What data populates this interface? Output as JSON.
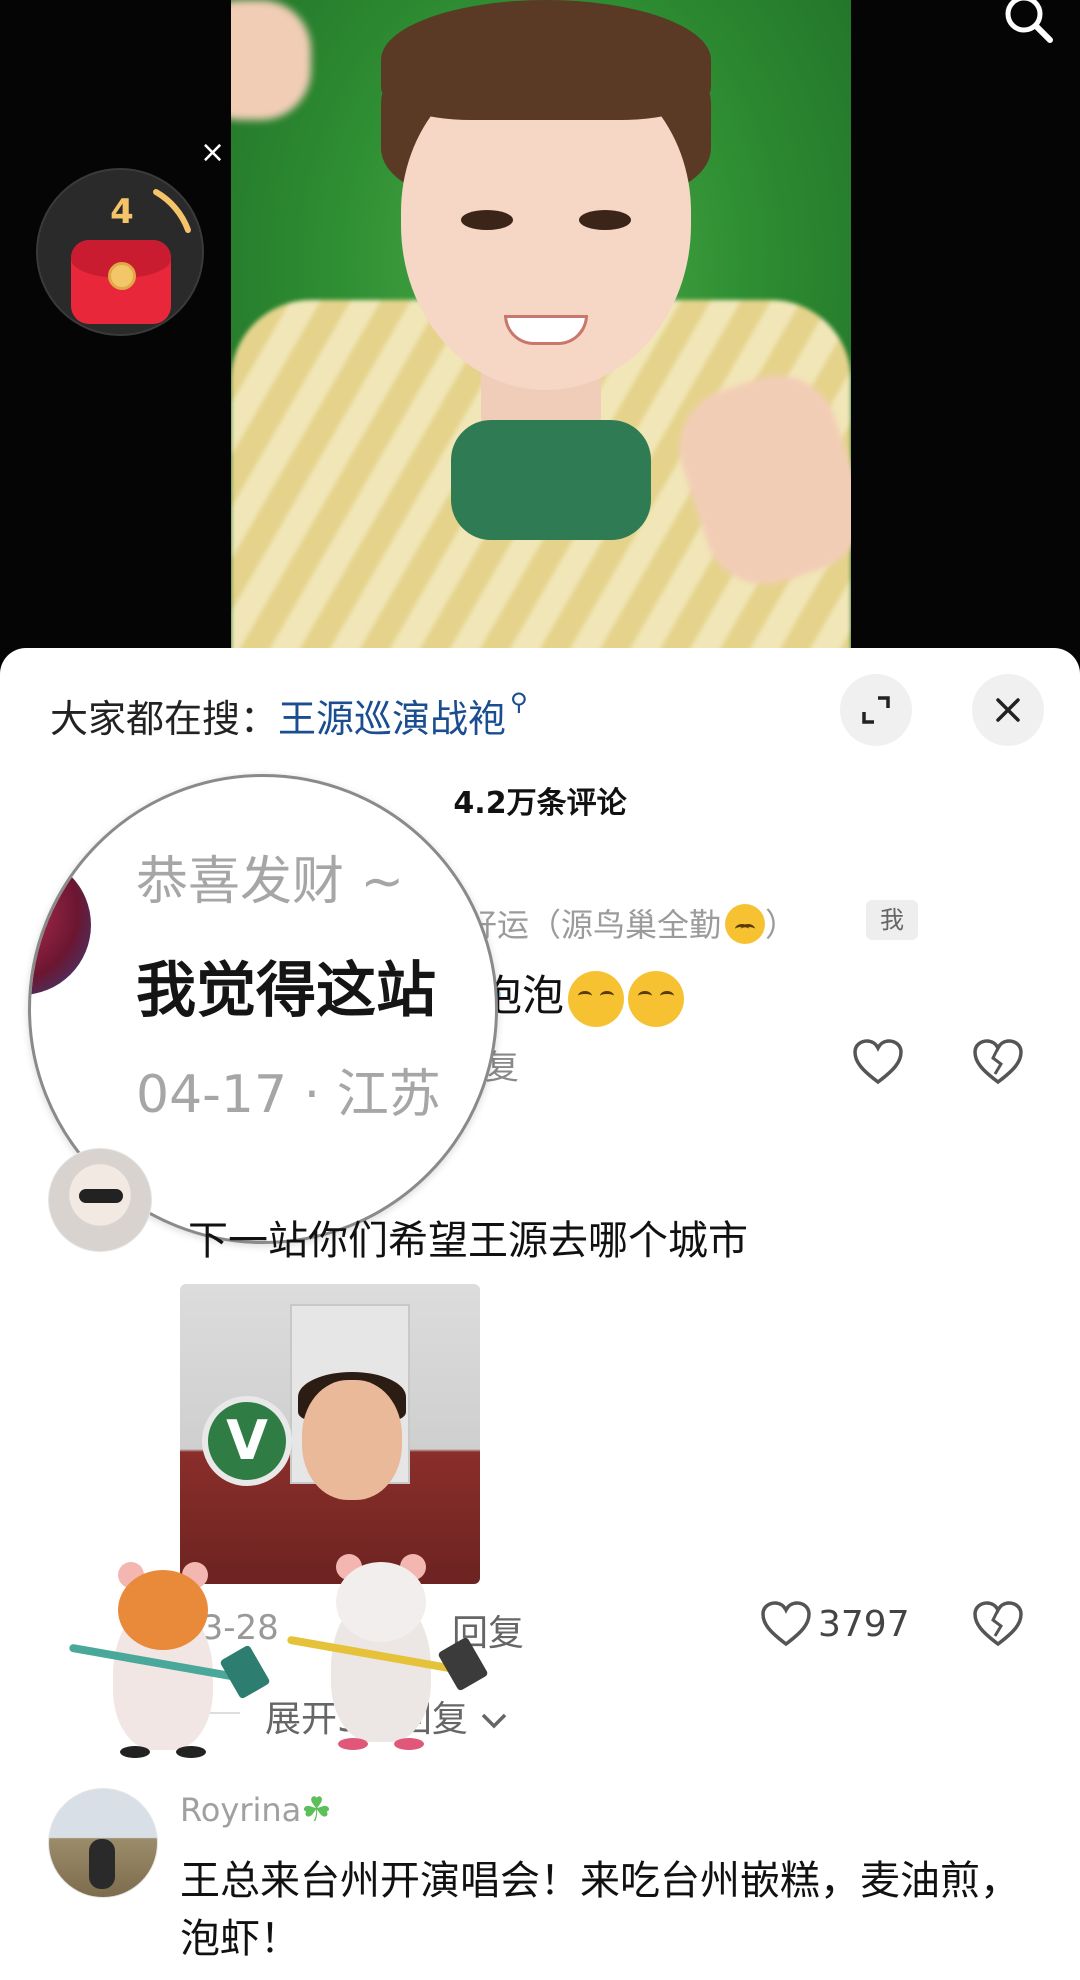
{
  "video": {
    "red_packet_count": "4",
    "close_glyph": "×"
  },
  "sheet": {
    "hot_search_prefix": "大家都在搜：",
    "hot_search_keyword": "王源巡演战袍",
    "comment_count_title": "4.2万条评论"
  },
  "comment1": {
    "magnified_username": "恭喜发财 ~ ",
    "magnified_text": "我觉得这站",
    "magnified_date": "04-17 · 江苏",
    "username_tail": "好运（源鸟巢全勤",
    "username_close": "）",
    "me_badge": "我",
    "text_tail": "泡泡",
    "reply_tail": "复"
  },
  "comment2": {
    "text": "下一站你们希望王源去哪个城市",
    "image_sign": "V",
    "date": "03-28",
    "reply_label": "回复",
    "likes": "3797",
    "expand_label": "展开5条回复"
  },
  "comment3": {
    "username": "Royrina",
    "text": "王总来台州开演唱会！来吃台州嵌糕，麦油煎，泡虾！"
  },
  "icons": {
    "search": "search-icon",
    "expand": "expand-icon",
    "close": "close-icon",
    "like": "heart-icon",
    "dislike": "broken-heart-icon",
    "chevron": "chevron-down-icon"
  },
  "colors": {
    "keyword_blue": "#1b4d91",
    "red_packet": "#e8273b",
    "muted_text": "#999999"
  }
}
